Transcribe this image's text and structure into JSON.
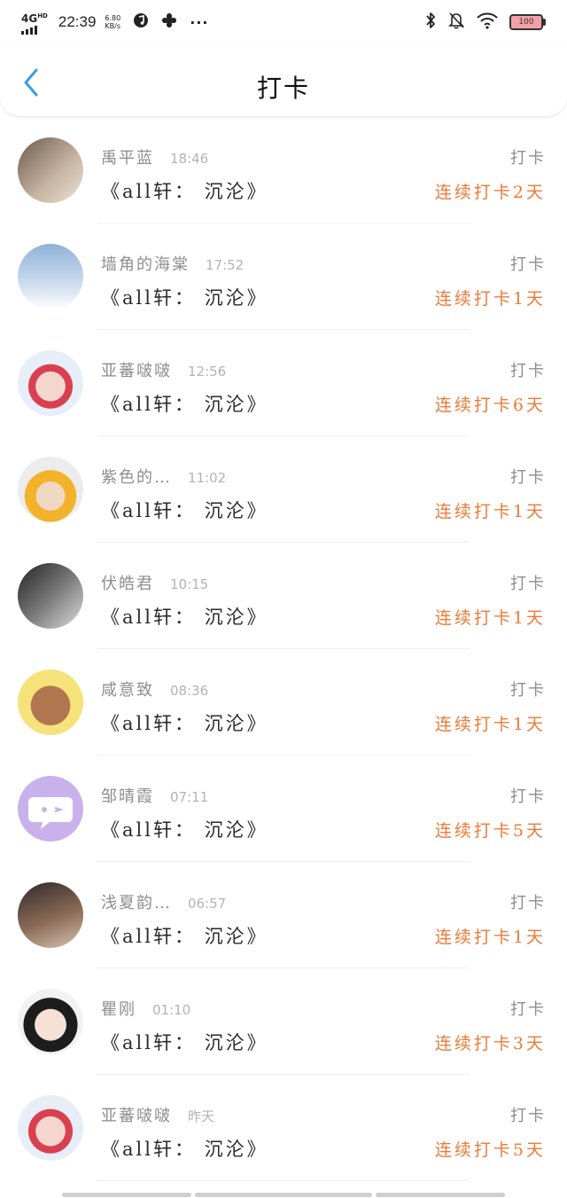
{
  "status_bar": {
    "network": "4G",
    "network_sup": "HD",
    "time": "22:39",
    "net_speed_value": "6.80",
    "net_speed_unit": "KB/s",
    "more_icons": "···",
    "battery_level": "100"
  },
  "nav": {
    "title": "打卡"
  },
  "colors": {
    "accent_back": "#3a9bea",
    "streak_orange": "#ee7a37"
  },
  "items": [
    {
      "name": "禹平蓝",
      "time": "18:46",
      "title": "《all轩： 沉沦》",
      "action": "打卡",
      "streak": "连续打卡2天"
    },
    {
      "name": "墙角的海棠",
      "time": "17:52",
      "title": "《all轩： 沉沦》",
      "action": "打卡",
      "streak": "连续打卡1天"
    },
    {
      "name": "亚蕃啵啵",
      "time": "12:56",
      "title": "《all轩： 沉沦》",
      "action": "打卡",
      "streak": "连续打卡6天"
    },
    {
      "name": "紫色的…",
      "time": "11:02",
      "title": "《all轩： 沉沦》",
      "action": "打卡",
      "streak": "连续打卡1天"
    },
    {
      "name": "伏皓君",
      "time": "10:15",
      "title": "《all轩： 沉沦》",
      "action": "打卡",
      "streak": "连续打卡1天"
    },
    {
      "name": "咸意致",
      "time": "08:36",
      "title": "《all轩： 沉沦》",
      "action": "打卡",
      "streak": "连续打卡1天"
    },
    {
      "name": "邹晴霞",
      "time": "07:11",
      "title": "《all轩： 沉沦》",
      "action": "打卡",
      "streak": "连续打卡5天"
    },
    {
      "name": "浅夏韵…",
      "time": "06:57",
      "title": "《all轩： 沉沦》",
      "action": "打卡",
      "streak": "连续打卡1天"
    },
    {
      "name": "瞿刚",
      "time": "01:10",
      "title": "《all轩： 沉沦》",
      "action": "打卡",
      "streak": "连续打卡3天"
    },
    {
      "name": "亚蕃啵啵",
      "time": "昨天",
      "title": "《all轩： 沉沦》",
      "action": "打卡",
      "streak": "连续打卡5天"
    }
  ]
}
